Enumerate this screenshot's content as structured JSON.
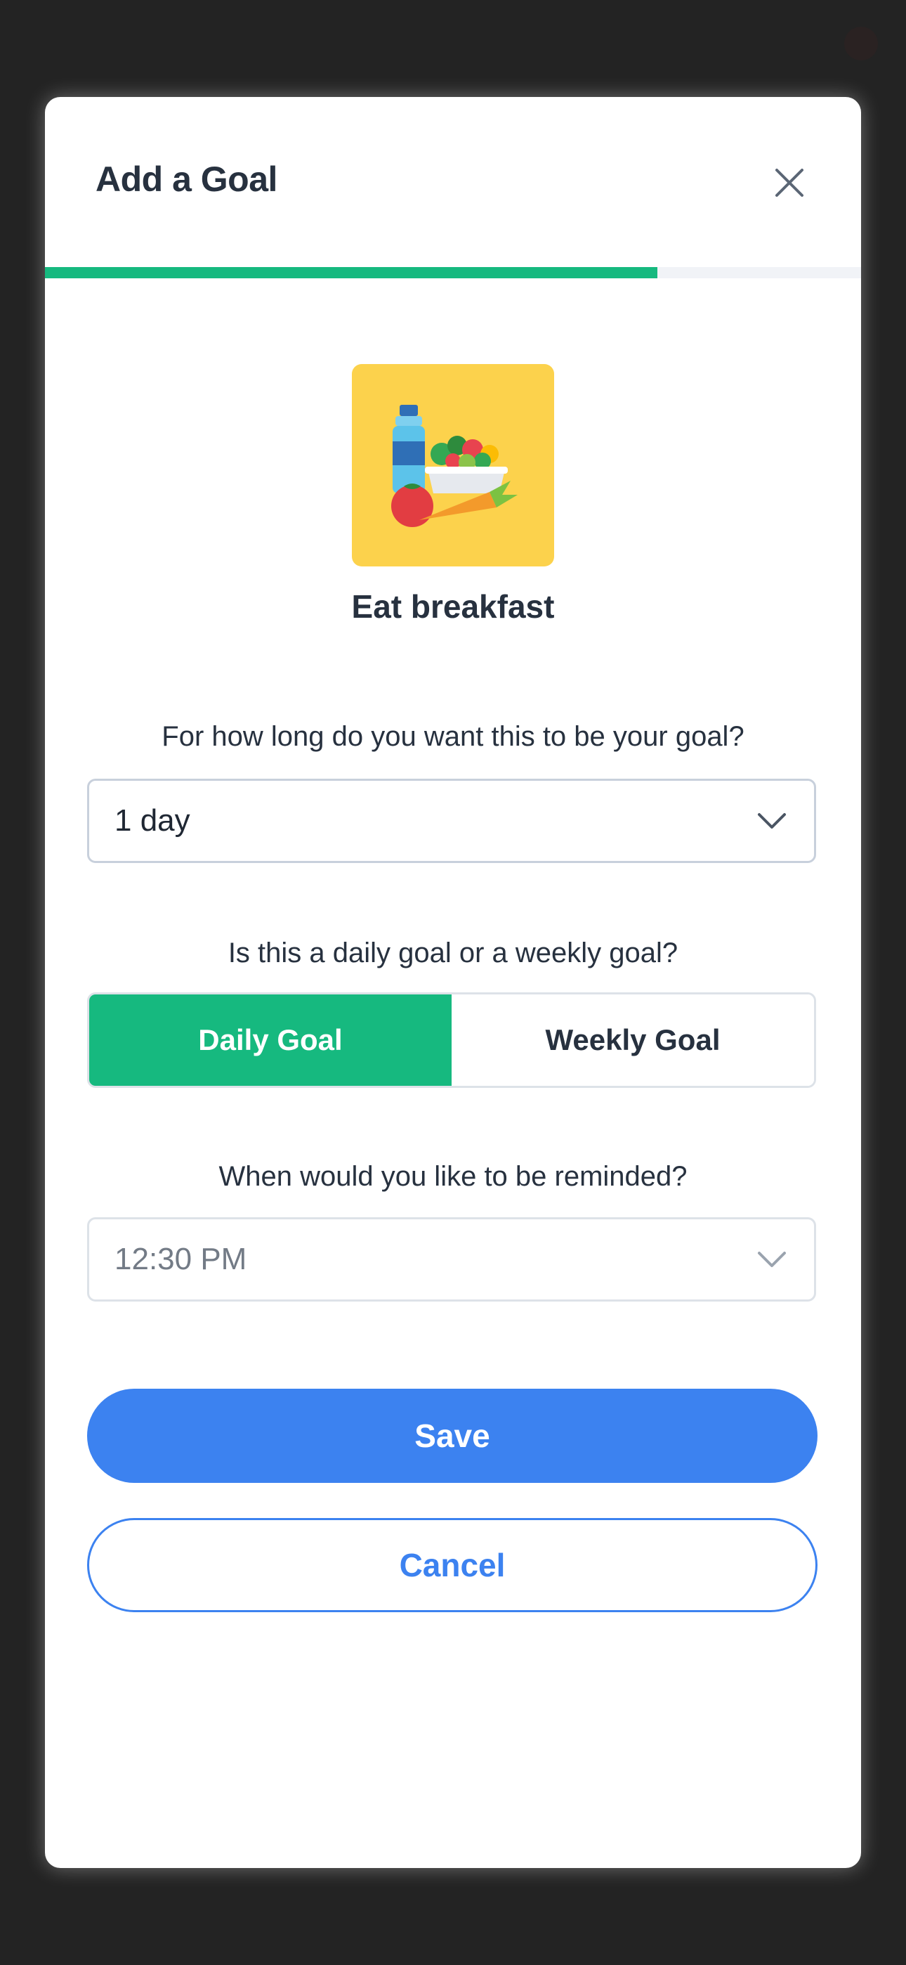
{
  "modal": {
    "title": "Add a Goal",
    "close_icon": "close-icon",
    "progress": 0.75
  },
  "goal": {
    "name": "Eat breakfast",
    "image_icon": "breakfast-food-illustration"
  },
  "duration": {
    "question": "For how long do you want this to be your goal?",
    "selected": "1 day",
    "icon": "chevron-down-icon"
  },
  "frequency": {
    "question": "Is this a daily goal or a weekly goal?",
    "options": [
      "Daily Goal",
      "Weekly Goal"
    ],
    "selected": "Daily Goal"
  },
  "reminder": {
    "question": "When would you like to be reminded?",
    "placeholder": "12:30 PM",
    "icon": "chevron-down-icon"
  },
  "actions": {
    "save_label": "Save",
    "cancel_label": "Cancel"
  },
  "colors": {
    "accent_green": "#16b97f",
    "primary_blue": "#3c82f0",
    "image_background": "#fcd24c",
    "text_dark": "#27313f"
  }
}
